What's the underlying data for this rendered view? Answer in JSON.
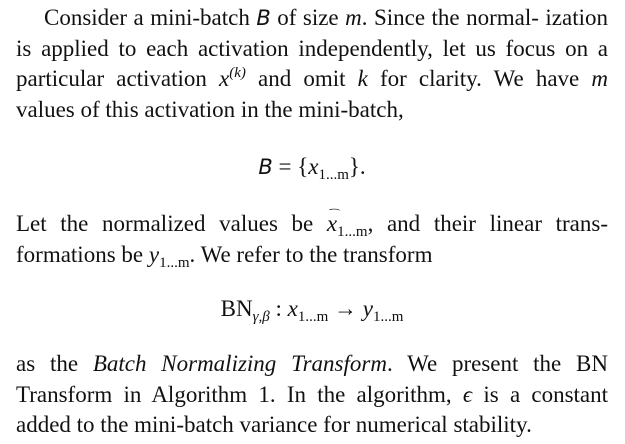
{
  "para1": {
    "l1a": "Consider a mini-batch ",
    "calB": "B",
    "l1b": " of size ",
    "m": "m",
    "l1c": ". Since the normal-",
    "l2": "ization is applied to each activation independently, let us",
    "l3a": "focus on a particular activation ",
    "x": "x",
    "sup": "(k)",
    "l3b": " and omit ",
    "k": "k",
    "l3c": " for clarity.",
    "l4a": "We have ",
    "l4b": " values of this activation in the mini-batch,"
  },
  "eq1": {
    "calB": "B",
    "rel": " = {",
    "x": "x",
    "sub": "1...m",
    "close": "}."
  },
  "para2": {
    "l1a": "Let the normalized values be ",
    "xhat": "x",
    "sub": "1...m",
    "l1b": ", and their linear trans-",
    "l2a": "formations be ",
    "y": "y",
    "l2b": ". We refer to the transform"
  },
  "eq2": {
    "bn": "BN",
    "sub": "γ,β",
    "colon": " : ",
    "x": "x",
    "xsub": "1...m",
    "arrow": " → ",
    "y": "y",
    "ysub": "1...m"
  },
  "para3": {
    "l1a": "as the ",
    "em": "Batch Normalizing Transform",
    "l1b": ". We present the BN",
    "l2a": "Transform in Algorithm 1. In the algorithm, ",
    "eps": "ϵ",
    "l2b": " is a constant",
    "l3": "added to the mini-batch variance for numerical stability."
  }
}
